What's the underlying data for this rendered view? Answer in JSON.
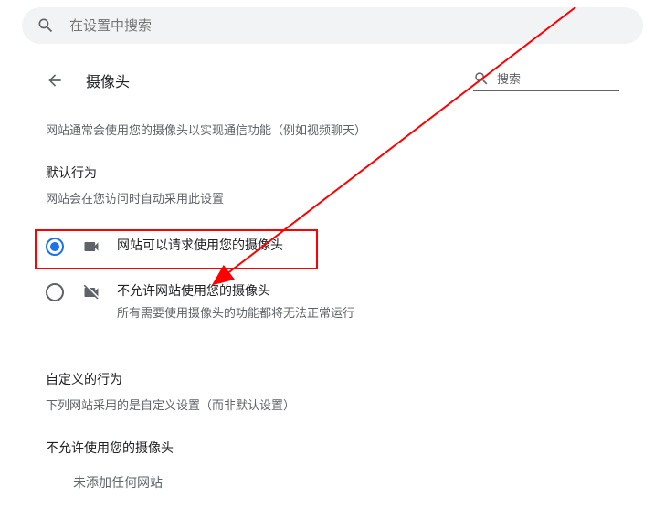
{
  "topSearch": {
    "placeholder": "在设置中搜索"
  },
  "header": {
    "title": "摄像头",
    "miniSearch": "搜索"
  },
  "description": "网站通常会使用您的摄像头以实现通信功能（例如视频聊天）",
  "defaultBehavior": {
    "title": "默认行为",
    "subtitle": "网站会在您访问时自动采用此设置"
  },
  "options": {
    "allow": {
      "label": "网站可以请求使用您的摄像头"
    },
    "block": {
      "label": "不允许网站使用您的摄像头",
      "desc": "所有需要使用摄像头的功能都将无法正常运行"
    }
  },
  "custom": {
    "title": "自定义的行为",
    "subtitle": "下列网站采用的是自定义设置（而非默认设置）"
  },
  "blocked": {
    "title": "不允许使用您的摄像头",
    "noSites": "未添加任何网站"
  }
}
